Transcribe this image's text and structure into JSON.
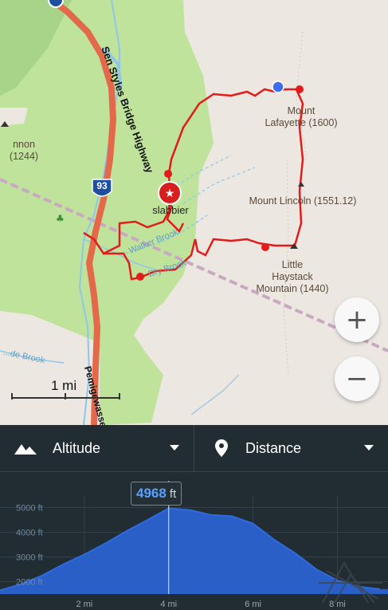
{
  "map": {
    "road_label": "Sen Styles Bridge Highway",
    "road_label_bottom": "Pemigewasset",
    "brook_label_1": "Walker Brook",
    "brook_label_2": "Dry Brook",
    "brook_label_3": "...de Brook",
    "interstate_shield": "93",
    "place_labels": {
      "cannon": "nnon\n(1244)",
      "lafayette": "Mount\nLafayette (1600)",
      "lincoln": "Mount Lincoln (1551.12)",
      "little_haystack": "Little\nHaystack\nMountain (1440)",
      "marker": "slabbier"
    },
    "scale_label": "1 mi",
    "zoom_in": "+",
    "zoom_out": "−",
    "colors": {
      "park": "#bfe39b",
      "route": "#e21b1b",
      "road": "#e4694a",
      "water": "#8fc7e8",
      "base": "#ece7e1"
    }
  },
  "panel": {
    "left_dropdown": {
      "label": "Altitude",
      "icon": "mountains-icon"
    },
    "right_dropdown": {
      "label": "Distance",
      "icon": "location-pin-icon"
    },
    "badge": {
      "value": "4968",
      "unit": "ft"
    },
    "y_labels": [
      "5000 ft",
      "4000 ft",
      "3000 ft",
      "2000 ft"
    ],
    "x_labels": [
      "2 mi",
      "4 mi",
      "6 mi",
      "8 mi"
    ]
  },
  "chart_data": {
    "type": "area",
    "title": "",
    "xlabel": "",
    "ylabel": "",
    "x": [
      0,
      0.5,
      1,
      1.5,
      2,
      2.5,
      3,
      3.5,
      4,
      4.5,
      5,
      5.5,
      6,
      6.5,
      7,
      7.5,
      8,
      8.5,
      9
    ],
    "values": [
      1650,
      1900,
      2250,
      2700,
      3100,
      3550,
      4050,
      4500,
      4968,
      4900,
      4700,
      4650,
      4350,
      3700,
      3150,
      2500,
      2050,
      1800,
      1700
    ],
    "ylim": [
      1500,
      5500
    ],
    "xlim": [
      0,
      9.2
    ],
    "selected_x": 4,
    "selected_value": 4968
  }
}
